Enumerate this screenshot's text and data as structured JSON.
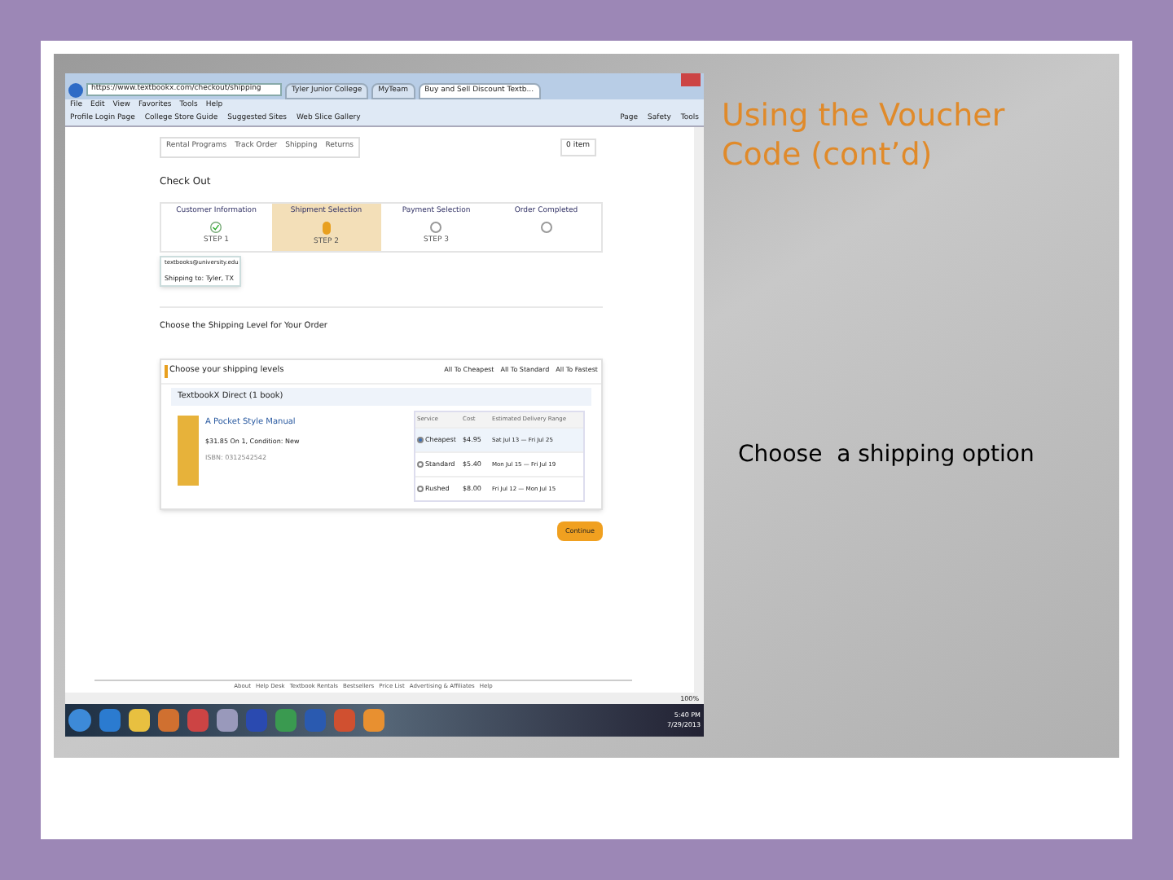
{
  "slide": {
    "title": "Using the Voucher Code (cont’d)",
    "body": "Choose  a shipping option"
  },
  "browser": {
    "address": "https://www.textbookx.com/checkout/shipping",
    "tabs": [
      {
        "label": "Tyler Junior College",
        "selected": false
      },
      {
        "label": "MyTeam",
        "selected": false
      },
      {
        "label": "Buy and Sell Discount Textb...",
        "selected": true
      }
    ],
    "menu": [
      "File",
      "Edit",
      "View",
      "Favorites",
      "Tools",
      "Help"
    ],
    "favorites": [
      "Profile Login Page",
      "College Store Guide",
      "Suggested Sites",
      "Web Slice Gallery"
    ],
    "command_bar": [
      "Page",
      "Safety",
      "Tools"
    ],
    "zoom": "100%"
  },
  "page": {
    "nav": [
      "Rental Programs",
      "Track Order",
      "Shipping",
      "Returns"
    ],
    "cart": "0 item",
    "heading": "Check Out",
    "steps": [
      {
        "label": "Customer Information",
        "step": "STEP 1",
        "kind": "done"
      },
      {
        "label": "Shipment Selection",
        "step": "STEP 2",
        "kind": "current"
      },
      {
        "label": "Payment Selection",
        "step": "STEP 3",
        "kind": "pending"
      },
      {
        "label": "Order Completed",
        "kind": "pending"
      }
    ],
    "account": {
      "email": "textbooks@university.edu",
      "shipping_to": "Shipping to: Tyler, TX"
    },
    "section_title": "Choose the Shipping Level for Your Order",
    "shipping": {
      "title": "Choose your shipping levels",
      "shortcuts": [
        "All To Cheapest",
        "All To Standard",
        "All To Fastest"
      ],
      "seller": "TextbookX Direct (1 book)",
      "book": {
        "title": "A Pocket Style Manual",
        "price": "$31.85 On 1, Condition: New",
        "isbn": "ISBN: 0312542542"
      },
      "columns": [
        "Service",
        "Cost",
        "Estimated Delivery Range"
      ],
      "options": [
        {
          "service": "Cheapest",
          "cost": "$4.95",
          "range": "Sat Jul 13 — Fri Jul 25",
          "selected": true
        },
        {
          "service": "Standard",
          "cost": "$5.40",
          "range": "Mon Jul 15 — Fri Jul 19",
          "selected": false
        },
        {
          "service": "Rushed",
          "cost": "$8.00",
          "range": "Fri Jul 12 — Mon Jul 15",
          "selected": false
        }
      ]
    },
    "continue": "Continue",
    "footer": [
      "About",
      "Help Desk",
      "Textbook Rentals",
      "Bestsellers",
      "Price List",
      "Advertising & Affiliates",
      "Help"
    ]
  },
  "taskbar": {
    "time": "5:40 PM",
    "date": "7/29/2013"
  }
}
